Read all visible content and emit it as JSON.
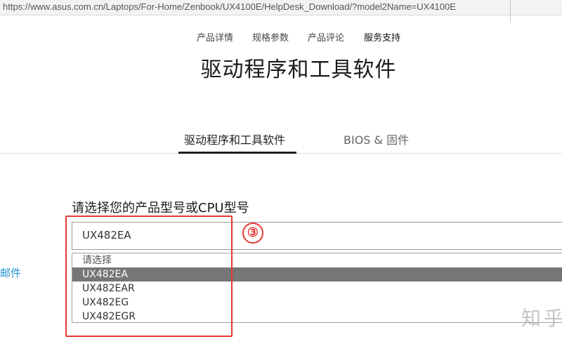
{
  "browser": {
    "url": "https://www.asus.com.cn/Laptops/For-Home/Zenbook/UX4100E/HelpDesk_Download/?model2Name=UX4100E"
  },
  "product_nav": {
    "items": [
      {
        "label": "产品详情"
      },
      {
        "label": "规格参数"
      },
      {
        "label": "产品评论"
      },
      {
        "label": "服务支持"
      }
    ]
  },
  "page": {
    "title": "驱动程序和工具软件"
  },
  "tabs": [
    {
      "label": "驱动程序和工具软件",
      "active": true
    },
    {
      "label": "BIOS & 固件",
      "active": false
    }
  ],
  "model_select": {
    "label": "请选择您的产品型号或CPU型号",
    "value": "UX482EA",
    "options": [
      "请选择",
      "UX482EA",
      "UX482EAR",
      "UX482EG",
      "UX482EGR"
    ],
    "selected_index": 1
  },
  "annotation": {
    "number": "③",
    "color": "#e53935"
  },
  "sidebar": {
    "link_text": "邮件"
  },
  "watermark": {
    "text": "知乎"
  },
  "colors": {
    "selected_option_bg": "#767676",
    "link": "#1a8fd0"
  }
}
